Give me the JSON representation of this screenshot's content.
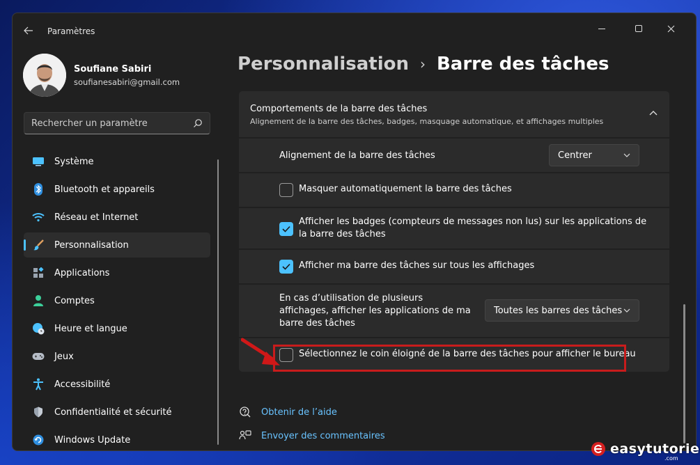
{
  "window": {
    "title": "Paramètres"
  },
  "user": {
    "name": "Soufiane Sabiri",
    "email": "soufianesabiri@gmail.com"
  },
  "search": {
    "placeholder": "Rechercher un paramètre"
  },
  "sidebar": {
    "items": [
      {
        "label": "Système",
        "icon": "monitor-icon",
        "active": false
      },
      {
        "label": "Bluetooth et appareils",
        "icon": "bluetooth-icon",
        "active": false
      },
      {
        "label": "Réseau et Internet",
        "icon": "wifi-icon",
        "active": false
      },
      {
        "label": "Personnalisation",
        "icon": "brush-icon",
        "active": true
      },
      {
        "label": "Applications",
        "icon": "apps-icon",
        "active": false
      },
      {
        "label": "Comptes",
        "icon": "person-icon",
        "active": false
      },
      {
        "label": "Heure et langue",
        "icon": "globe-clock-icon",
        "active": false
      },
      {
        "label": "Jeux",
        "icon": "gamepad-icon",
        "active": false
      },
      {
        "label": "Accessibilité",
        "icon": "accessibility-icon",
        "active": false
      },
      {
        "label": "Confidentialité et sécurité",
        "icon": "shield-icon",
        "active": false
      },
      {
        "label": "Windows Update",
        "icon": "update-icon",
        "active": false
      }
    ]
  },
  "breadcrumb": {
    "parent": "Personnalisation",
    "separator": "›",
    "current": "Barre des tâches"
  },
  "section": {
    "title": "Comportements de la barre des tâches",
    "subtitle": "Alignement de la barre des tâches, badges, masquage automatique, et affichages multiples"
  },
  "settings": {
    "alignment": {
      "label": "Alignement de la barre des tâches",
      "value": "Centrer"
    },
    "autohide": {
      "label": "Masquer automatiquement la barre des tâches",
      "checked": false
    },
    "badges": {
      "label": "Afficher les badges (compteurs de messages non lus) sur les applications de la barre des tâches",
      "checked": true
    },
    "all_displays": {
      "label": "Afficher ma barre des tâches sur tous les affichages",
      "checked": true
    },
    "multi_display": {
      "label": "En cas d’utilisation de plusieurs affichages, afficher les applications de ma barre des tâches",
      "value": "Toutes les barres des tâches"
    },
    "far_corner": {
      "label": "Sélectionnez le coin éloigné de la barre des tâches pour afficher le bureau",
      "checked": false
    }
  },
  "links": {
    "help": "Obtenir de l’aide",
    "feedback": "Envoyer des commentaires"
  },
  "watermark": {
    "brand": "easytutoriel",
    "domain": ".com"
  },
  "colors": {
    "accent": "#4cc2ff",
    "link": "#69c3ff",
    "highlight": "#c81c1c",
    "window_bg": "#202020",
    "card_bg": "#2b2b2b"
  }
}
